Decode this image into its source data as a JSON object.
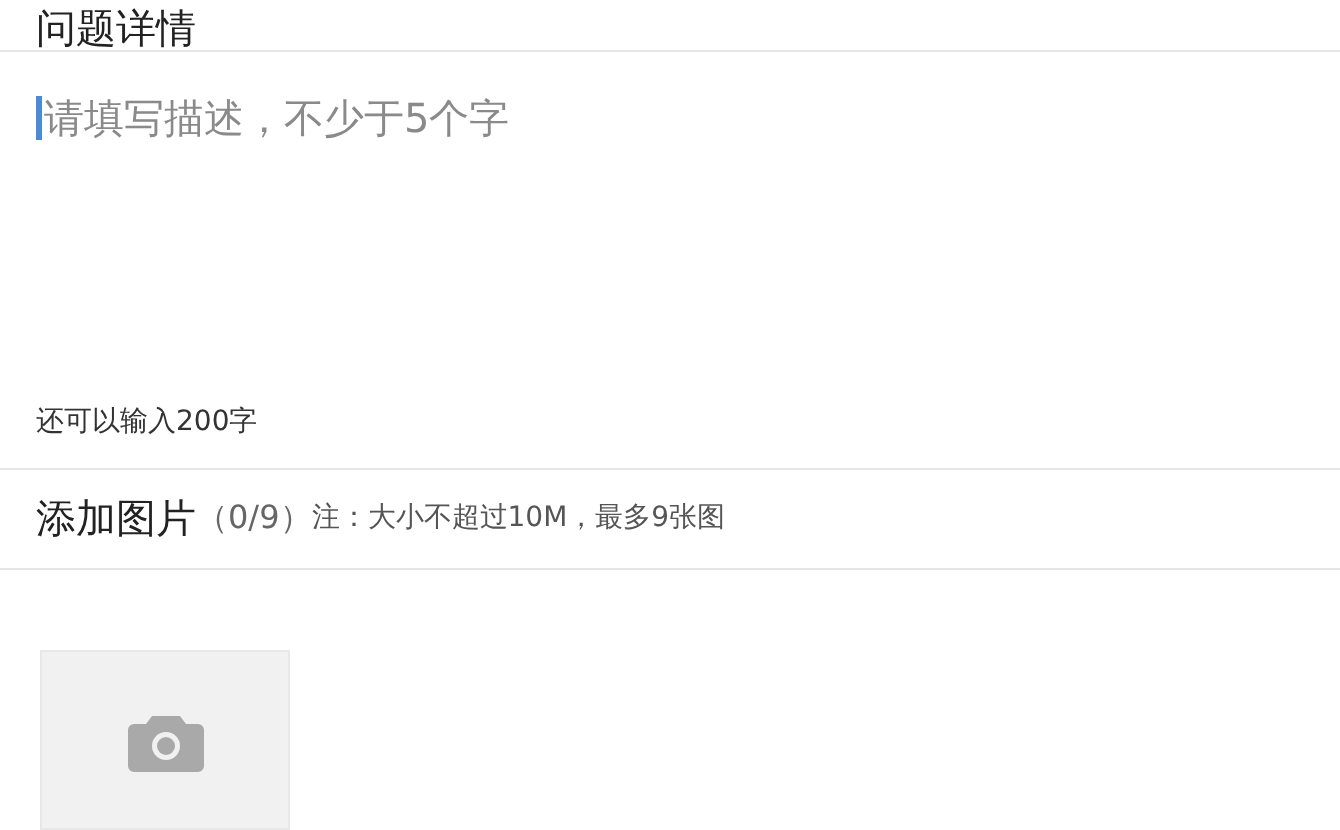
{
  "section_title": "问题详情",
  "description": {
    "placeholder": "请填写描述，不少于5个字",
    "focused": true
  },
  "remaining_hint": "还可以输入200字",
  "add_photos": {
    "title": "添加图片",
    "count": "（0/9）",
    "note": "注：大小不超过10M，最多9张图"
  }
}
